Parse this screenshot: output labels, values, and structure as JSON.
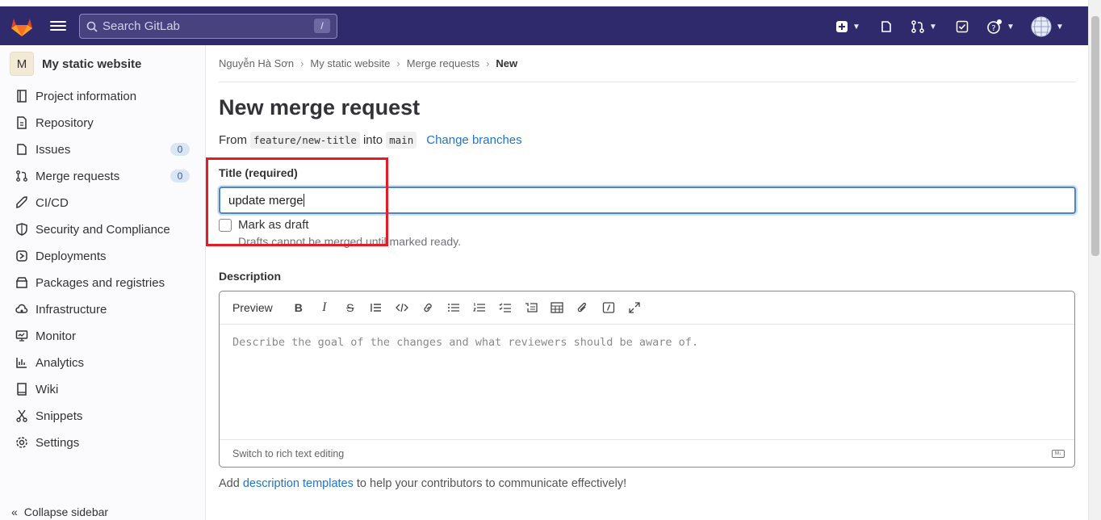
{
  "navbar": {
    "search_placeholder": "Search GitLab",
    "search_shortcut": "/"
  },
  "sidebar": {
    "project_avatar": "M",
    "project_name": "My static website",
    "items": [
      {
        "label": "Project information",
        "icon": "info-icon"
      },
      {
        "label": "Repository",
        "icon": "doc-icon"
      },
      {
        "label": "Issues",
        "icon": "issues-icon",
        "count": "0"
      },
      {
        "label": "Merge requests",
        "icon": "merge-request-icon",
        "count": "0"
      },
      {
        "label": "CI/CD",
        "icon": "rocket-icon"
      },
      {
        "label": "Security and Compliance",
        "icon": "shield-icon"
      },
      {
        "label": "Deployments",
        "icon": "deployments-icon"
      },
      {
        "label": "Packages and registries",
        "icon": "package-icon"
      },
      {
        "label": "Infrastructure",
        "icon": "cloud-icon"
      },
      {
        "label": "Monitor",
        "icon": "monitor-icon"
      },
      {
        "label": "Analytics",
        "icon": "chart-icon"
      },
      {
        "label": "Wiki",
        "icon": "book-icon"
      },
      {
        "label": "Snippets",
        "icon": "scissors-icon"
      },
      {
        "label": "Settings",
        "icon": "gear-icon"
      }
    ],
    "collapse": "Collapse sidebar"
  },
  "breadcrumb": [
    "Nguyễn Hà Sơn",
    "My static website",
    "Merge requests",
    "New"
  ],
  "page": {
    "title": "New merge request",
    "from_label": "From",
    "source_branch": "feature/new-title",
    "into_label": "into",
    "target_branch": "main",
    "change_branches": "Change branches"
  },
  "form": {
    "title_label": "Title (required)",
    "title_value": "update merge",
    "draft_label": "Mark as draft",
    "draft_help": "Drafts cannot be merged until marked ready.",
    "description_label": "Description",
    "preview": "Preview",
    "description_placeholder": "Describe the goal of the changes and what reviewers should be aware of.",
    "switch_rich": "Switch to rich text editing",
    "help_prefix": "Add",
    "help_link": "description templates",
    "help_suffix": "to help your contributors to communicate effectively!"
  }
}
